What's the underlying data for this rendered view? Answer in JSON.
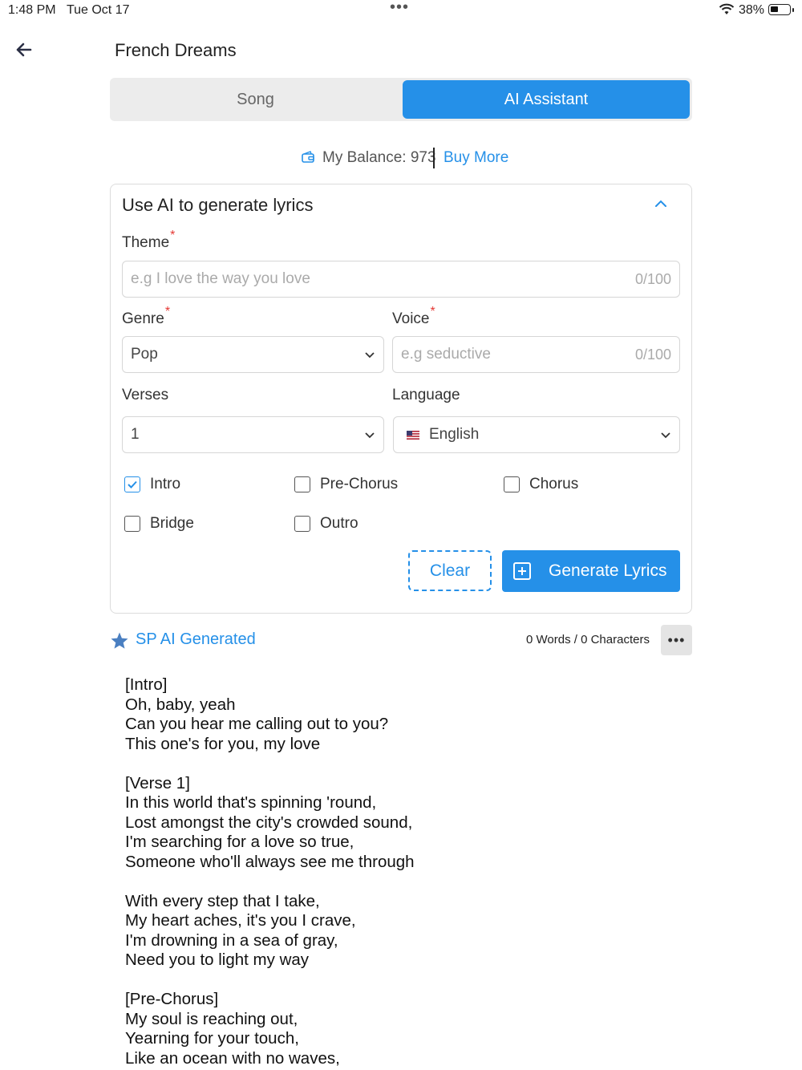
{
  "status": {
    "time": "1:48 PM",
    "date": "Tue Oct 17",
    "battery": "38%"
  },
  "header": {
    "title": "French Dreams"
  },
  "tabs": [
    {
      "label": "Song",
      "active": false
    },
    {
      "label": "AI Assistant",
      "active": true
    }
  ],
  "balance": {
    "text": "My Balance: 973",
    "buy_more": "Buy More"
  },
  "form": {
    "title": "Use AI to generate lyrics",
    "theme": {
      "label": "Theme",
      "placeholder": "e.g I love the way you love",
      "count": "0/100"
    },
    "genre": {
      "label": "Genre",
      "value": "Pop"
    },
    "voice": {
      "label": "Voice",
      "placeholder": "e.g seductive",
      "count": "0/100"
    },
    "verses": {
      "label": "Verses",
      "value": "1"
    },
    "language": {
      "label": "Language",
      "value": "English"
    },
    "sections": [
      {
        "label": "Intro",
        "checked": true
      },
      {
        "label": "Pre-Chorus",
        "checked": false
      },
      {
        "label": "Chorus",
        "checked": false
      },
      {
        "label": "Bridge",
        "checked": false
      },
      {
        "label": "Outro",
        "checked": false
      }
    ],
    "clear_label": "Clear",
    "generate_label": "Generate Lyrics",
    "required_mark": "*"
  },
  "generated": {
    "title": "SP AI Generated",
    "counts": "0 Words / 0 Characters",
    "more": "•••",
    "lyrics": [
      "[Intro]",
      "Oh, baby, yeah",
      "Can you hear me calling out to you?",
      "This one's for you, my love",
      "",
      "[Verse 1]",
      "In this world that's spinning 'round,",
      "Lost amongst the city's crowded sound,",
      "I'm searching for a love so true,",
      "Someone who'll always see me through",
      "",
      "With every step that I take,",
      "My heart aches, it's you I crave,",
      "I'm drowning in a sea of gray,",
      "Need you to light my way",
      "",
      "[Pre-Chorus]",
      "My soul is reaching out,",
      "Yearning for your touch,",
      "Like an ocean with no waves,"
    ]
  },
  "colors": {
    "accent": "#2590e8",
    "required": "#e53935"
  },
  "icons": {
    "back": "arrow-left-icon",
    "balance": "wallet-icon",
    "collapse": "chevron-up-icon",
    "dropdown": "chevron-down-icon",
    "generated": "star-icon"
  }
}
